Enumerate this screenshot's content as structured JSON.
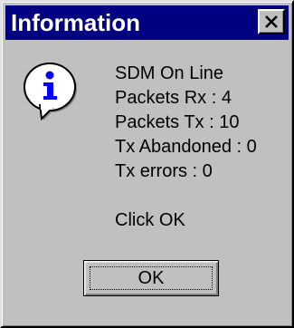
{
  "dialog": {
    "title": "Information",
    "close_symbol": "✕",
    "icon": "information-icon",
    "message_lines": [
      "SDM On Line",
      "Packets Rx : 4",
      "Packets Tx : 10",
      "Tx Abandoned : 0",
      "Tx errors : 0"
    ],
    "prompt": "Click OK",
    "ok_label": "OK"
  },
  "colors": {
    "titlebar": "#000080",
    "face": "#c0c0c0",
    "icon_fill": "#ffffff",
    "icon_letter": "#0000ff"
  }
}
